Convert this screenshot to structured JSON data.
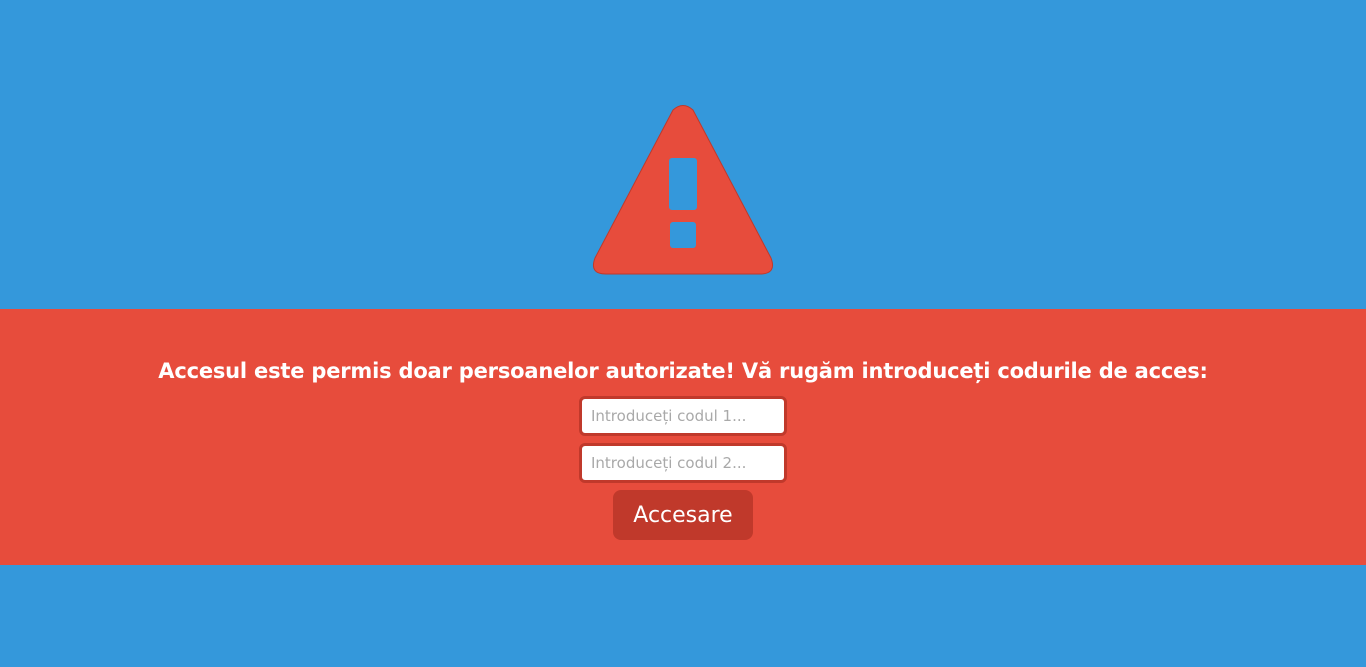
{
  "colors": {
    "background": "#3498db",
    "band": "#e74c3c",
    "accent_dark": "#c0392b",
    "text": "#ffffff"
  },
  "icon": "warning-triangle-icon",
  "message": "Accesul este permis doar persoanelor autorizate! Vă rugăm introduceți codurile de acces:",
  "form": {
    "code1": {
      "value": "",
      "placeholder": "Introduceți codul 1..."
    },
    "code2": {
      "value": "",
      "placeholder": "Introduceți codul 2..."
    },
    "submit_label": "Accesare"
  }
}
